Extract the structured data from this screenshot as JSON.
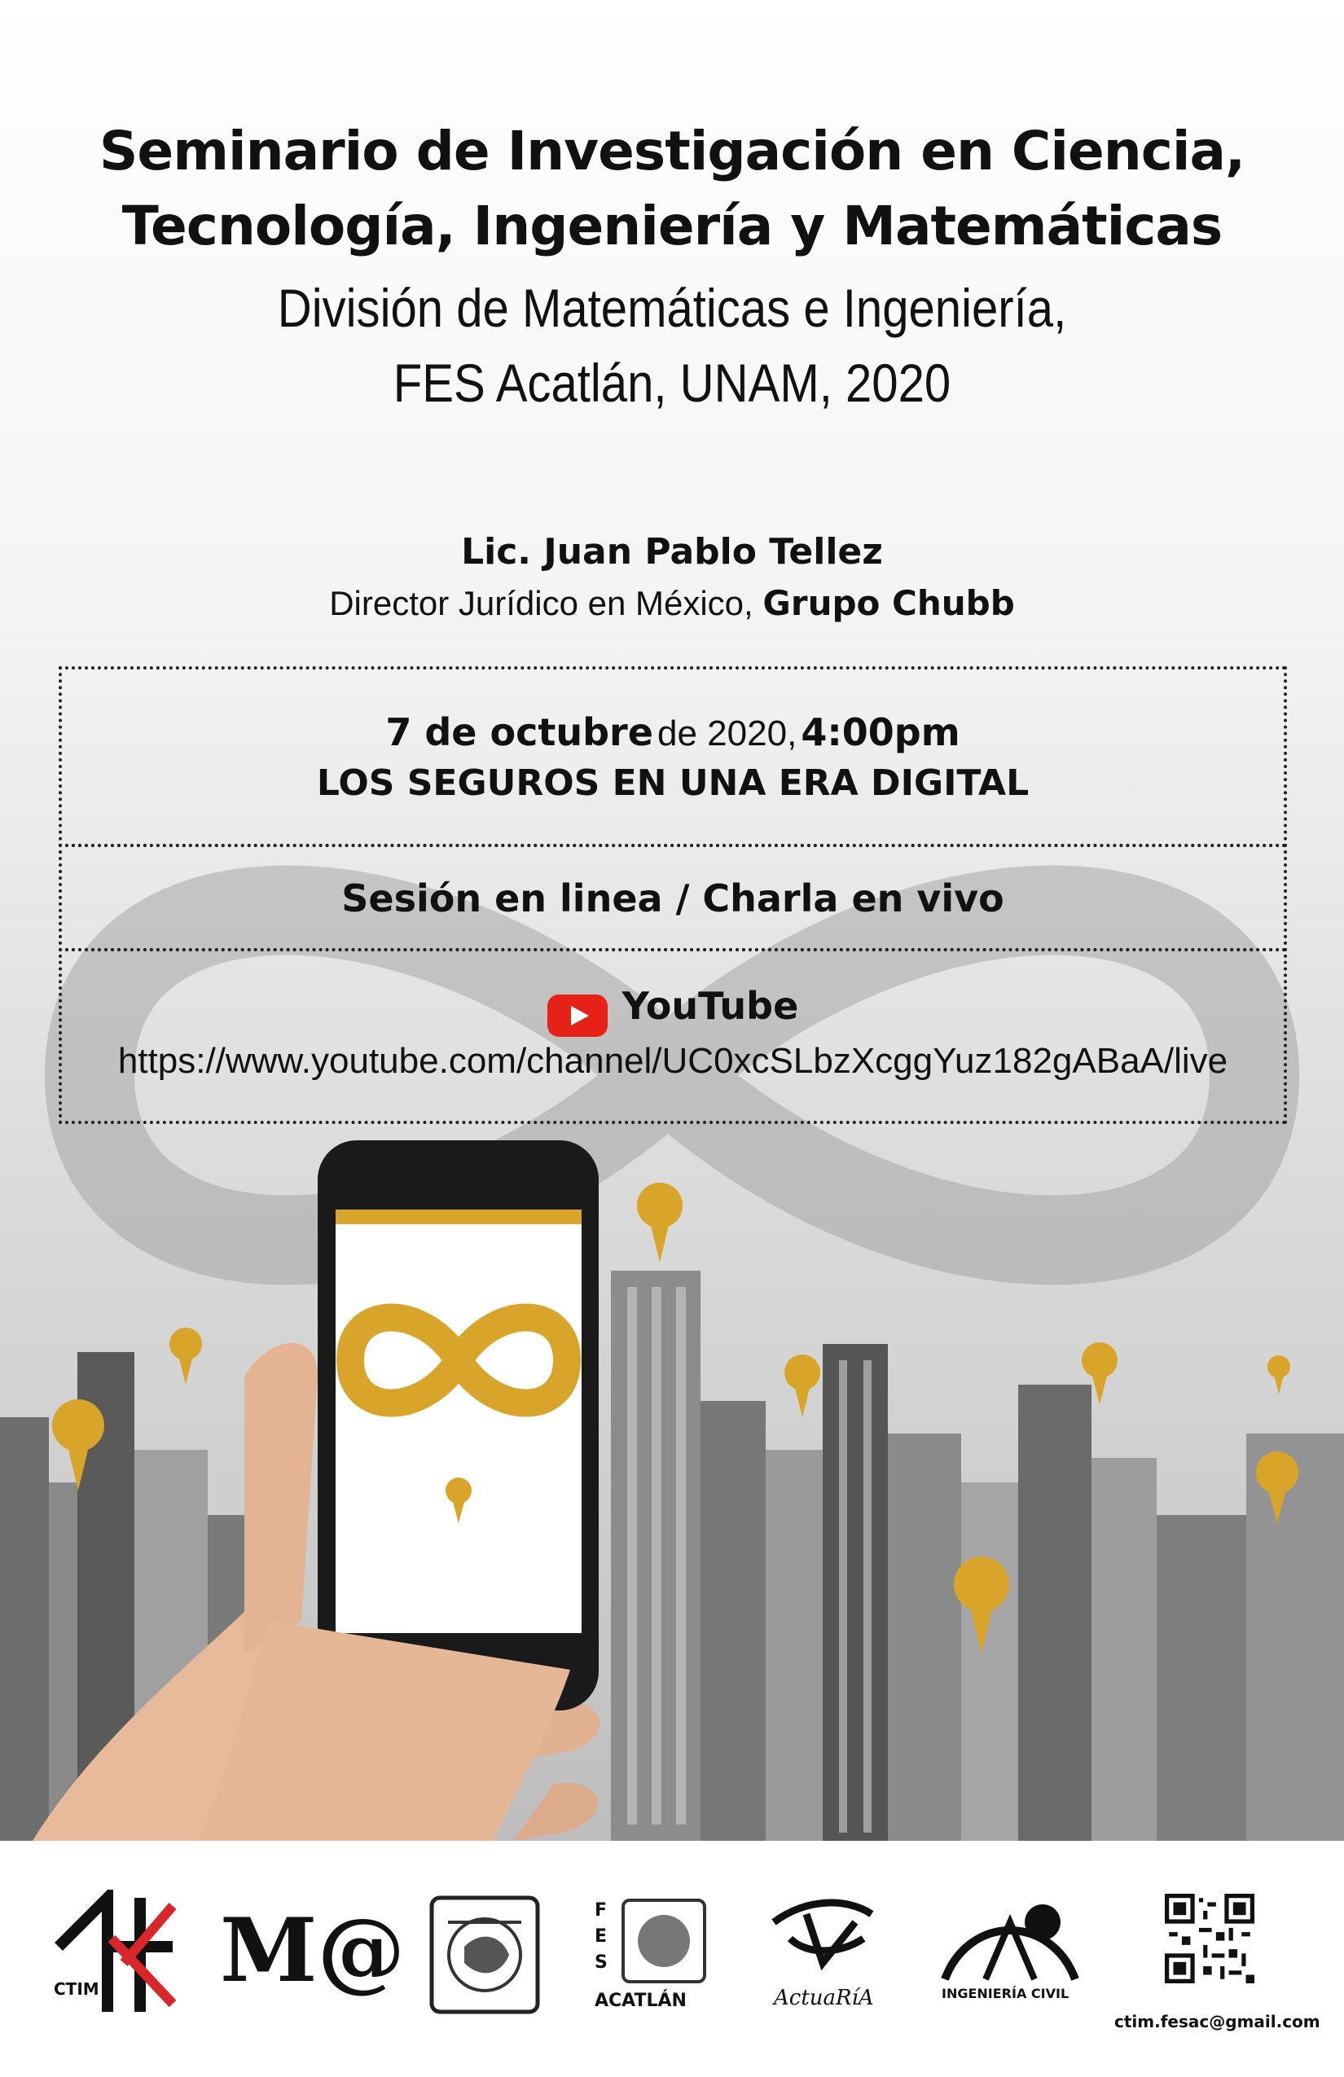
{
  "header": {
    "title_line1": "Seminario de Investigación en Ciencia,",
    "title_line2": "Tecnología, Ingeniería y Matemáticas",
    "subtitle_line1": "División de Matemáticas e Ingeniería,",
    "subtitle_line2": "FES Acatlán, UNAM, 2020"
  },
  "speaker": {
    "name": "Lic. Juan Pablo Tellez",
    "role": "Director Jurídico en México,",
    "company": "Grupo Chubb"
  },
  "event": {
    "date_bold": "7 de octubre",
    "date_rest": "de 2020,",
    "time": "4:00pm",
    "talk_title": "LOS SEGUROS EN UNA ERA DIGITAL",
    "mode": "Sesión en linea / Charla en vivo",
    "platform": "YouTube",
    "url": "https://www.youtube.com/channel/UC0xcSLbzXcggYuz182gABaA/live"
  },
  "footer": {
    "logo_ctim": "CTIM",
    "logo_ma": "M@",
    "logo_fes_letters": "F E S",
    "logo_acatlan": "ACATLÁN",
    "logo_actuaria": "ActuaRíA",
    "logo_ingenieria": "INGENIERÍA CIVIL",
    "email": "ctim.fesac@gmail.com"
  },
  "colors": {
    "accent_gold": "#d8a52a",
    "youtube_red": "#e62117",
    "ctim_red": "#d9262b"
  }
}
